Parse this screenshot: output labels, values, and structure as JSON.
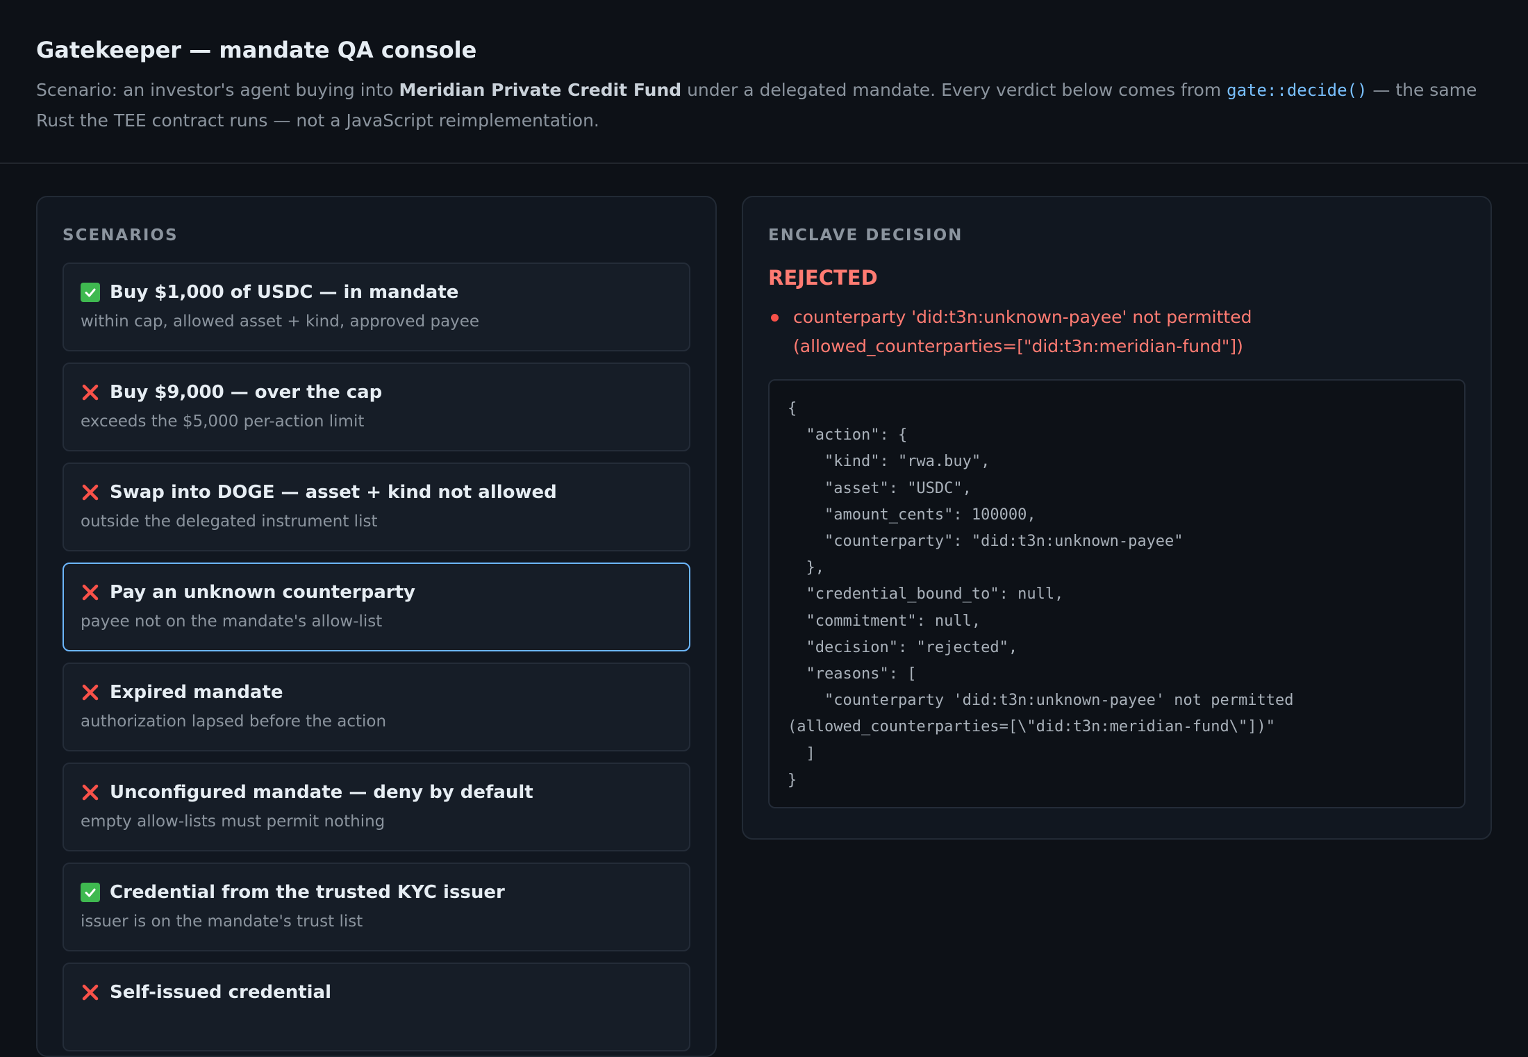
{
  "header": {
    "title": "Gatekeeper — mandate QA console",
    "subtitle_prefix": "Scenario: an investor's agent buying into ",
    "fund_name": "Meridian Private Credit Fund",
    "subtitle_middle": " under a delegated mandate. Every verdict below comes from ",
    "code_ref": "gate::decide()",
    "subtitle_suffix": " — the same Rust the TEE contract runs — not a JavaScript reimplementation."
  },
  "scenarios": {
    "label": "SCENARIOS",
    "items": [
      {
        "icon": "check-icon",
        "title": "Buy $1,000 of USDC — in mandate",
        "desc": "within cap, allowed asset + kind, approved payee"
      },
      {
        "icon": "cross-icon",
        "title": "Buy $9,000 — over the cap",
        "desc": "exceeds the $5,000 per-action limit"
      },
      {
        "icon": "cross-icon",
        "title": "Swap into DOGE — asset + kind not allowed",
        "desc": "outside the delegated instrument list"
      },
      {
        "icon": "cross-icon",
        "title": "Pay an unknown counterparty",
        "desc": "payee not on the mandate's allow-list",
        "selected": true
      },
      {
        "icon": "cross-icon",
        "title": "Expired mandate",
        "desc": "authorization lapsed before the action"
      },
      {
        "icon": "cross-icon",
        "title": "Unconfigured mandate — deny by default",
        "desc": "empty allow-lists must permit nothing"
      },
      {
        "icon": "check-icon",
        "title": "Credential from the trusted KYC issuer",
        "desc": "issuer is on the mandate's trust list"
      },
      {
        "icon": "cross-icon",
        "title": "Self-issued credential",
        "desc": ""
      }
    ]
  },
  "decision": {
    "label": "ENCLAVE DECISION",
    "verdict": "REJECTED",
    "reasons": [
      "counterparty 'did:t3n:unknown-payee' not permitted (allowed_counterparties=[\"did:t3n:meridian-fund\"])"
    ],
    "json": "{\n  \"action\": {\n    \"kind\": \"rwa.buy\",\n    \"asset\": \"USDC\",\n    \"amount_cents\": 100000,\n    \"counterparty\": \"did:t3n:unknown-payee\"\n  },\n  \"credential_bound_to\": null,\n  \"commitment\": null,\n  \"decision\": \"rejected\",\n  \"reasons\": [\n    \"counterparty 'did:t3n:unknown-payee' not permitted\n(allowed_counterparties=[\\\"did:t3n:meridian-fund\\\"])\"\n  ]\n}"
  },
  "colors": {
    "background": "#0d1117",
    "panel": "#111720",
    "accent": "#6cb6ff",
    "rejected": "#ff7b72",
    "approved": "#3fb950"
  }
}
